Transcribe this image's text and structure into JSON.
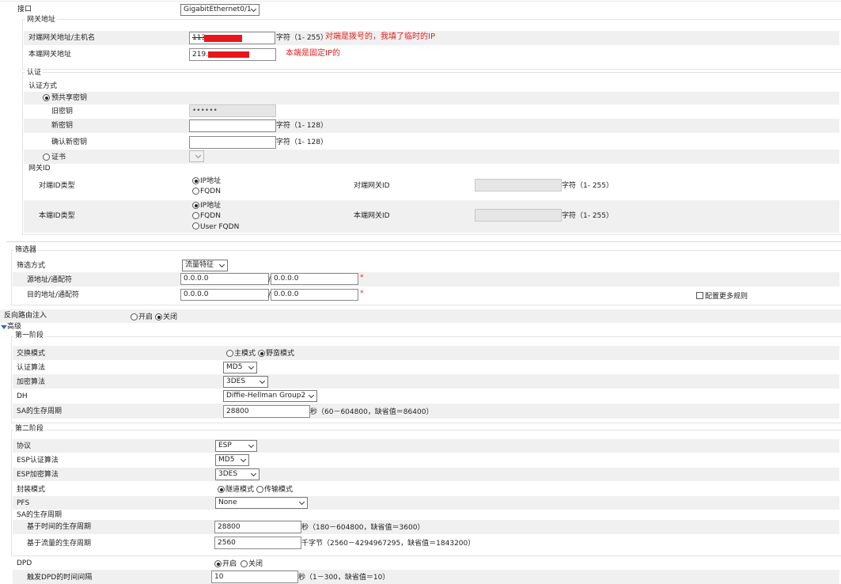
{
  "interface": {
    "label": "接口",
    "value": "GigabitEthernet0/1"
  },
  "gateway": {
    "section_title": "网关地址",
    "peer_label": "对端网关地址/主机名",
    "peer_value": "113.",
    "peer_hint": "字符（1- 255）",
    "peer_note": "对端是拨号的，我填了临时的IP",
    "local_label": "本端网关地址",
    "local_value": "219.",
    "local_note": "本端是固定IP的"
  },
  "auth": {
    "section_title": "认证",
    "method_label": "认证方式",
    "psk_label": "预共享密钥",
    "old_key_label": "旧密钥",
    "old_key_value": "••••••",
    "new_key_label": "新密钥",
    "new_key_hint": "字符（1- 128）",
    "confirm_key_label": "确认新密钥",
    "confirm_key_hint": "字符（1- 128）",
    "cert_label": "证书",
    "gateway_id_label": "网关ID",
    "peer_id_type_label": "对端ID类型",
    "peer_id_options": [
      "IP地址",
      "FQDN"
    ],
    "peer_gw_id_label": "对端网关ID",
    "peer_gw_id_hint": "字符（1- 255）",
    "local_id_type_label": "本端ID类型",
    "local_id_options": [
      "IP地址",
      "FQDN",
      "User FQDN"
    ],
    "local_gw_id_label": "本端网关ID",
    "local_gw_id_hint": "字符（1- 255）"
  },
  "filter": {
    "section_title": "筛选器",
    "method_label": "筛选方式",
    "method_value": "流量特征",
    "src_label": "源地址/通配符",
    "src_ip": "0.0.0.0",
    "sep1": "/",
    "src_wildcard": "0.0.0.0",
    "dst_label": "目的地址/通配符",
    "dst_ip": "0.0.0.0",
    "sep2": "/",
    "dst_wildcard": "0.0.0.0",
    "required_mark": "*",
    "more_rules_label": "配置更多规则"
  },
  "reverse_route": {
    "label": "反向路由注入",
    "on_label": "开启",
    "off_label": "关闭"
  },
  "advanced": {
    "label": "高级"
  },
  "phase1": {
    "title": "第一阶段",
    "exchange_label": "交换模式",
    "main_mode": "主模式",
    "aggressive_mode": "野蛮模式",
    "auth_algo_label": "认证算法",
    "auth_algo_value": "MD5",
    "enc_algo_label": "加密算法",
    "enc_algo_value": "3DES",
    "dh_label": "DH",
    "dh_value": "Diffie-Hellman Group2",
    "sa_life_label": "SA的生存周期",
    "sa_life_value": "28800",
    "sa_life_hint": "秒（60－604800，缺省值＝86400）"
  },
  "phase2": {
    "title": "第二阶段",
    "protocol_label": "协议",
    "protocol_value": "ESP",
    "esp_auth_label": "ESP认证算法",
    "esp_auth_value": "MD5",
    "esp_enc_label": "ESP加密算法",
    "esp_enc_value": "3DES",
    "encap_label": "封装模式",
    "tunnel_mode": "隧道模式",
    "transport_mode": "传输模式",
    "pfs_label": "PFS",
    "pfs_value": "None",
    "sa_life_label": "SA的生存周期",
    "time_life_label": "基于时间的生存周期",
    "time_life_value": "28800",
    "time_life_hint": "秒（180－604800，缺省值＝3600）",
    "traffic_life_label": "基于流量的生存周期",
    "traffic_life_value": "2560",
    "traffic_life_hint": "千字节（2560－4294967295，缺省值＝1843200）"
  },
  "dpd": {
    "label": "DPD",
    "on_label": "开启",
    "off_label": "关闭",
    "interval_label": "触发DPD的时间间隔",
    "interval_value": "10",
    "interval_hint": "秒（1－300，缺省值＝10）"
  },
  "colors": {
    "band": "#f0f0f0",
    "note_red": "#e02020",
    "triangle": "#1f6fc4"
  }
}
